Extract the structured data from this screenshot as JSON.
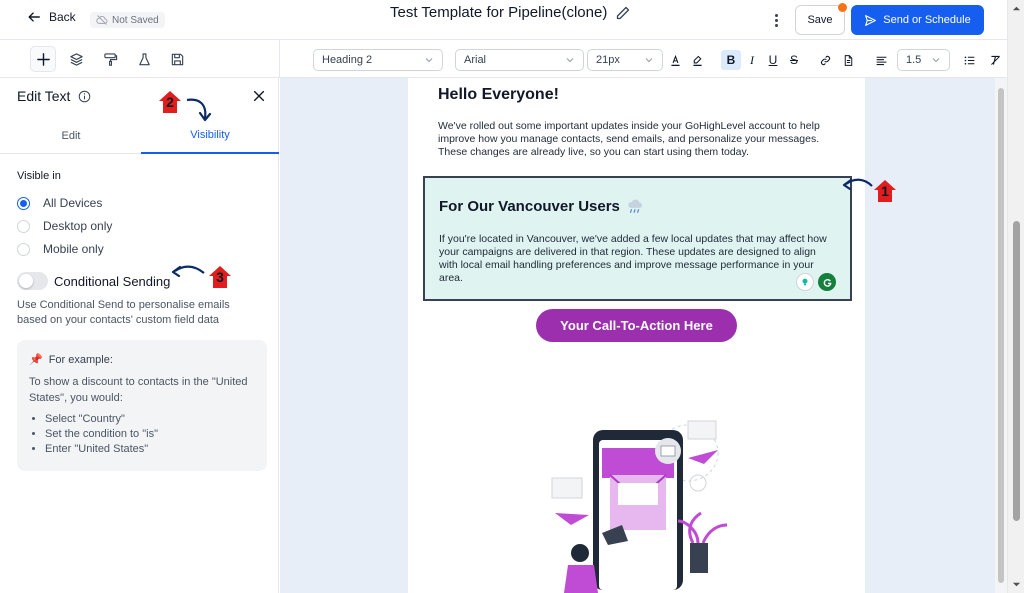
{
  "topbar": {
    "back_label": "Back",
    "status_label": "Not Saved",
    "title": "Test Template for Pipeline(clone)",
    "save_label": "Save",
    "send_label": "Send or Schedule"
  },
  "toolbar": {
    "block_style": "Heading 2",
    "font_family": "Arial",
    "font_size": "21px",
    "line_height": "1.5",
    "bold_active": true
  },
  "panel": {
    "title": "Edit Text",
    "tabs": [
      {
        "label": "Edit"
      },
      {
        "label": "Visibility"
      }
    ],
    "active_tab": "Visibility",
    "visible_in_label": "Visible in",
    "options": [
      {
        "label": "All Devices"
      },
      {
        "label": "Desktop only"
      },
      {
        "label": "Mobile only"
      }
    ],
    "selected_option": "All Devices",
    "conditional_label": "Conditional Sending",
    "conditional_enabled": false,
    "help_text": "Use Conditional Send to personalise emails based on your contacts' custom field data",
    "example": {
      "heading": "For example:",
      "text": "To show a discount to contacts in the \"United States\", you would:",
      "steps": [
        "Select \"Country\"",
        "Set the condition to \"is\"",
        "Enter \"United States\""
      ]
    }
  },
  "email": {
    "greeting": "Hello Everyone!",
    "intro": "We've rolled out some important updates inside your GoHighLevel account to help improve how you manage contacts, send emails, and personalize your messages. These changes are already live, so you can start using them today.",
    "block_title": "For Our Vancouver Users",
    "block_body": "If you're located in Vancouver, we've added a few local updates that may affect how your campaigns are delivered in that region. These updates are designed to align with local email handling preferences and improve message performance in your area.",
    "cta_label": "Your Call-To-Action Here"
  },
  "annotations": [
    "1",
    "2",
    "3"
  ],
  "colors": {
    "primary": "#155eef",
    "cta": "#9b2fae",
    "block_bg": "#dff3f0",
    "canvas_bg": "#e8eef7",
    "annotation_red": "#e11d1d"
  }
}
